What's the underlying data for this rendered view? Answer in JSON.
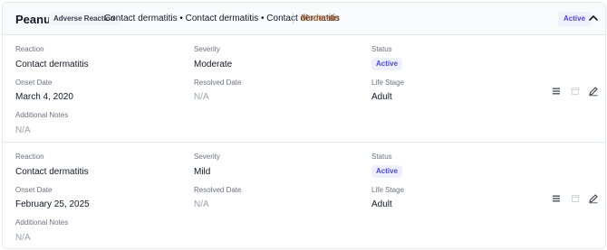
{
  "header": {
    "allergen": "Peanut",
    "type_badge": "Adverse Reaction",
    "reactions_summary": "Contact dermatitis • Contact dermatitis • Contact dermatitis",
    "severity_summary": "Moderate",
    "status": "Active"
  },
  "labels": {
    "reaction": "Reaction",
    "severity": "Severity",
    "status": "Status",
    "onset_date": "Onset Date",
    "resolved_date": "Resolved Date",
    "life_stage": "Life Stage",
    "additional_notes": "Additional Notes"
  },
  "entries": [
    {
      "reaction": "Contact dermatitis",
      "severity": "Moderate",
      "status": "Active",
      "onset_date": "March 4, 2020",
      "resolved_date": "N/A",
      "life_stage": "Adult",
      "additional_notes": "N/A"
    },
    {
      "reaction": "Contact dermatitis",
      "severity": "Mild",
      "status": "Active",
      "onset_date": "February 25, 2025",
      "resolved_date": "N/A",
      "life_stage": "Adult",
      "additional_notes": "N/A"
    }
  ],
  "icons": {
    "collapse": "chevron-up-icon",
    "details": "list-icon",
    "archive": "archive-icon",
    "edit": "edit-icon"
  },
  "colors": {
    "active_badge_bg": "#eef0fd",
    "active_badge_text": "#4f46e5",
    "moderate": "#b45309"
  }
}
